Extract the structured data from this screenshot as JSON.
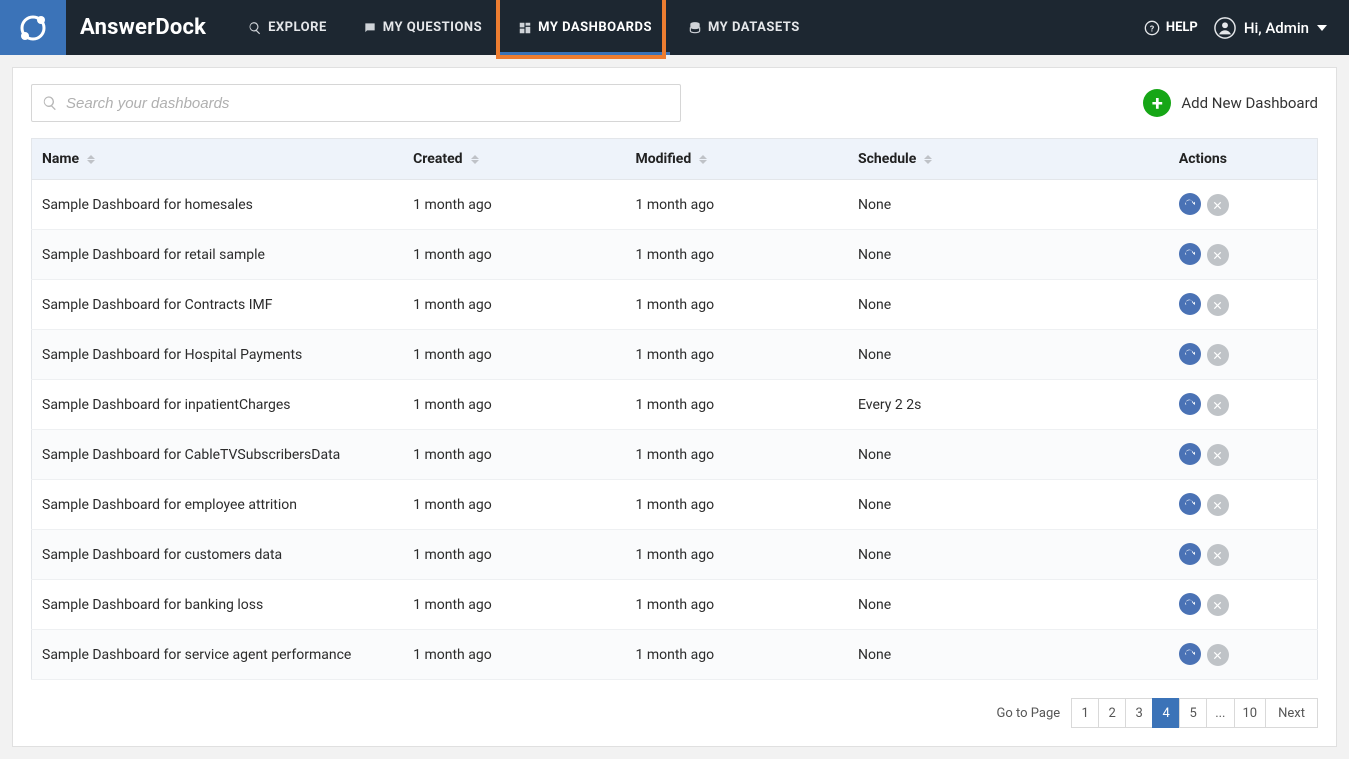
{
  "brand": "AnswerDock",
  "nav": {
    "explore": "EXPLORE",
    "my_questions": "MY QUESTIONS",
    "my_dashboards": "MY DASHBOARDS",
    "my_datasets": "MY DATASETS",
    "help": "HELP",
    "user_greeting": "Hi, Admin"
  },
  "toolbar": {
    "search_placeholder": "Search your dashboards",
    "add_label": "Add New Dashboard"
  },
  "table": {
    "headers": {
      "name": "Name",
      "created": "Created",
      "modified": "Modified",
      "schedule": "Schedule",
      "actions": "Actions"
    },
    "rows": [
      {
        "name": "Sample Dashboard for homesales",
        "created": "1 month ago",
        "modified": "1 month ago",
        "schedule": "None"
      },
      {
        "name": "Sample Dashboard for retail sample",
        "created": "1 month ago",
        "modified": "1 month ago",
        "schedule": "None"
      },
      {
        "name": "Sample Dashboard for Contracts IMF",
        "created": "1 month ago",
        "modified": "1 month ago",
        "schedule": "None"
      },
      {
        "name": "Sample Dashboard for Hospital Payments",
        "created": "1 month ago",
        "modified": "1 month ago",
        "schedule": "None"
      },
      {
        "name": "Sample Dashboard for inpatientCharges",
        "created": "1 month ago",
        "modified": "1 month ago",
        "schedule": "Every 2 2s"
      },
      {
        "name": "Sample Dashboard for CableTVSubscribersData",
        "created": "1 month ago",
        "modified": "1 month ago",
        "schedule": "None"
      },
      {
        "name": "Sample Dashboard for employee attrition",
        "created": "1 month ago",
        "modified": "1 month ago",
        "schedule": "None"
      },
      {
        "name": "Sample Dashboard for customers data",
        "created": "1 month ago",
        "modified": "1 month ago",
        "schedule": "None"
      },
      {
        "name": "Sample Dashboard for banking loss",
        "created": "1 month ago",
        "modified": "1 month ago",
        "schedule": "None"
      },
      {
        "name": "Sample Dashboard for service agent performance",
        "created": "1 month ago",
        "modified": "1 month ago",
        "schedule": "None"
      }
    ]
  },
  "pager": {
    "goto_label": "Go to Page",
    "pages": [
      "1",
      "2",
      "3",
      "4",
      "5",
      "...",
      "10"
    ],
    "active": "4",
    "next": "Next"
  }
}
